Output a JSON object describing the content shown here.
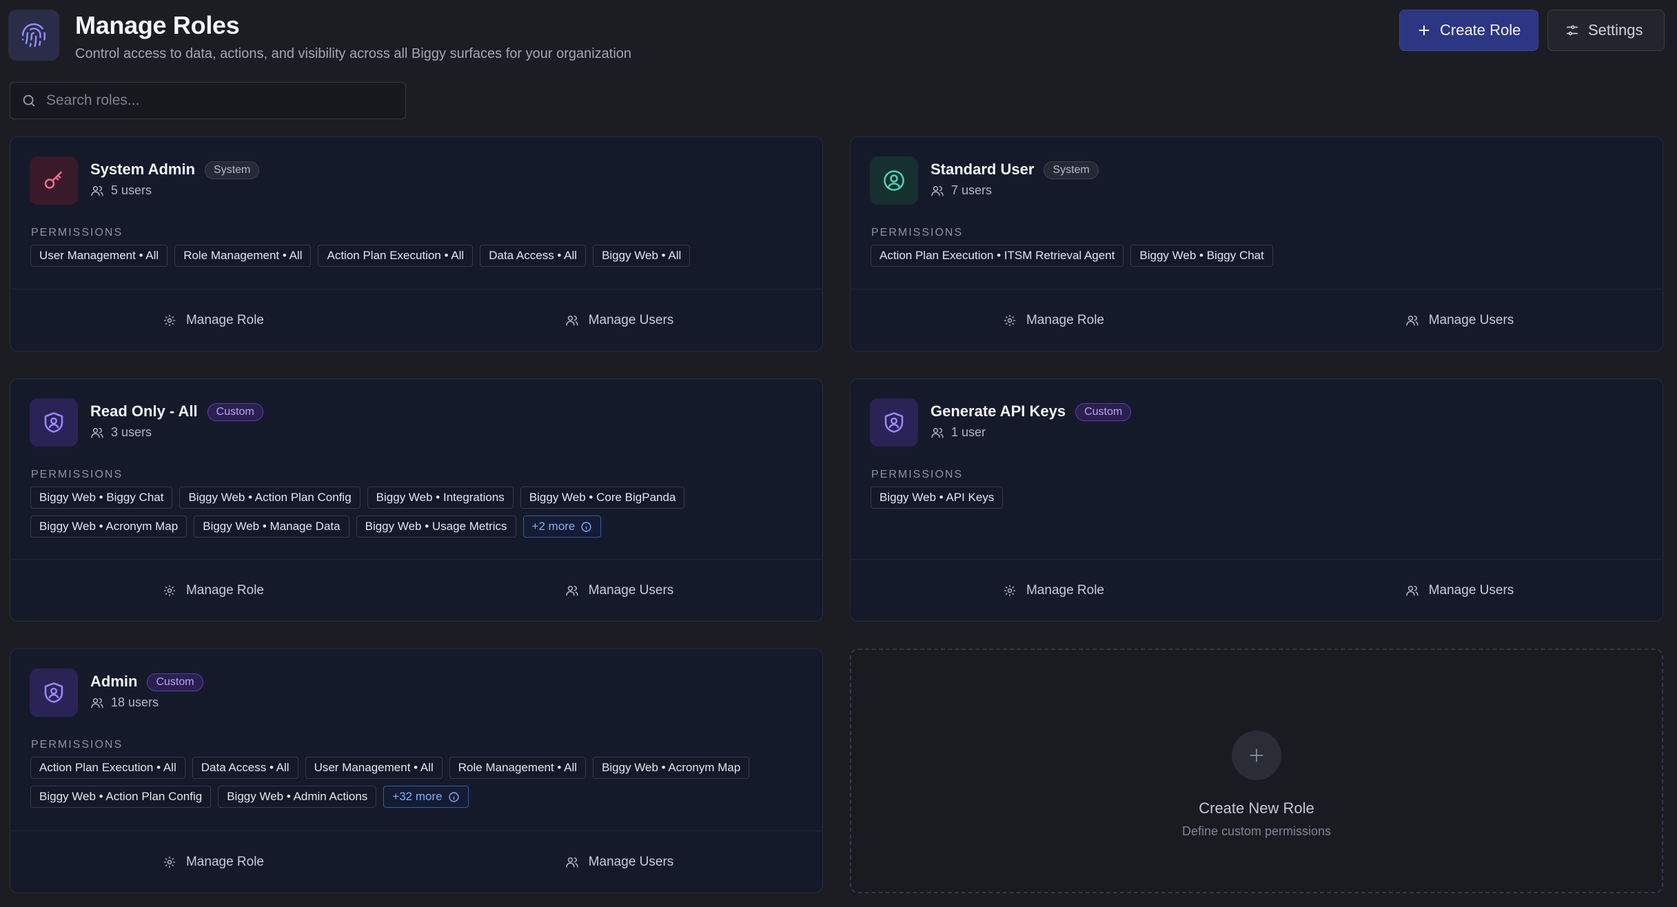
{
  "header": {
    "title": "Manage Roles",
    "subtitle": "Control access to data, actions, and visibility across all Biggy surfaces for your organization",
    "create_label": "Create Role",
    "settings_label": "Settings"
  },
  "search": {
    "placeholder": "Search roles..."
  },
  "colors": {
    "accent": "#2c3683",
    "system_badge": "#262a37",
    "custom_badge": "#5a3fb0",
    "more_link": "#7db0ff"
  },
  "permissions_label": "PERMISSIONS",
  "footer": {
    "manage_role": "Manage Role",
    "manage_users": "Manage Users"
  },
  "roles": [
    {
      "name": "System Admin",
      "badge": "System",
      "users": "5 users",
      "icon": "key-icon",
      "permissions": [
        "User Management • All",
        "Role Management • All",
        "Action Plan Execution • All",
        "Data Access • All",
        "Biggy Web • All"
      ],
      "more": ""
    },
    {
      "name": "Standard User",
      "badge": "System",
      "users": "7 users",
      "icon": "user-circle-icon",
      "permissions": [
        "Action Plan Execution • ITSM Retrieval Agent",
        "Biggy Web • Biggy Chat"
      ],
      "more": ""
    },
    {
      "name": "Read Only - All",
      "badge": "Custom",
      "users": "3 users",
      "icon": "shield-user-icon",
      "permissions": [
        "Biggy Web • Biggy Chat",
        "Biggy Web • Action Plan Config",
        "Biggy Web • Integrations",
        "Biggy Web • Core BigPanda",
        "Biggy Web • Acronym Map",
        "Biggy Web • Manage Data",
        "Biggy Web • Usage Metrics"
      ],
      "more": "+2 more"
    },
    {
      "name": "Generate API Keys",
      "badge": "Custom",
      "users": "1 user",
      "icon": "shield-user-icon",
      "permissions": [
        "Biggy Web • API Keys"
      ],
      "more": ""
    },
    {
      "name": "Admin",
      "badge": "Custom",
      "users": "18 users",
      "icon": "shield-user-icon",
      "permissions": [
        "Action Plan Execution • All",
        "Data Access • All",
        "User Management • All",
        "Role Management • All",
        "Biggy Web • Acronym Map",
        "Biggy Web • Action Plan Config",
        "Biggy Web • Admin Actions"
      ],
      "more": "+32 more"
    }
  ],
  "create_card": {
    "title": "Create New Role",
    "subtitle": "Define custom permissions"
  }
}
